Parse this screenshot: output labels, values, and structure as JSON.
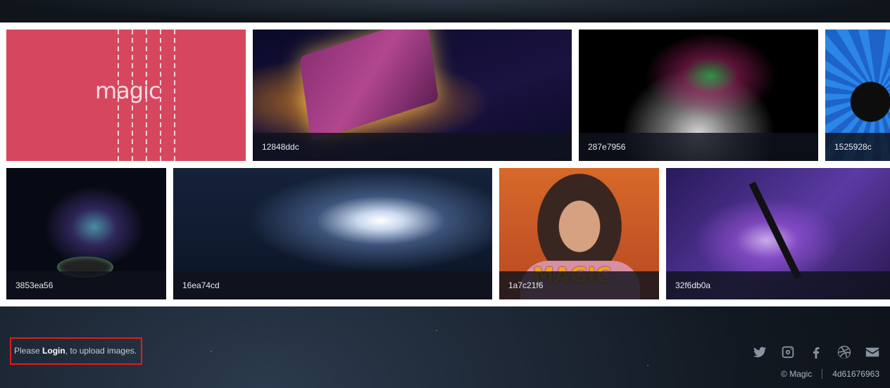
{
  "gallery": {
    "items": [
      {
        "label": "",
        "word": "magic"
      },
      {
        "label": "12848ddc"
      },
      {
        "label": "287e7956"
      },
      {
        "label": "1525928c"
      },
      {
        "label": "3853ea56"
      },
      {
        "label": "16ea74cd"
      },
      {
        "label": "1a7c21f6",
        "word": "MAGIC"
      },
      {
        "label": "32f6db0a"
      }
    ]
  },
  "footer": {
    "login_prefix": "Please ",
    "login_link": "Login",
    "login_suffix": ", to upload images.",
    "copyright": "© Magic",
    "version": "4d61676963"
  },
  "social": [
    "twitter-icon",
    "instagram-icon",
    "facebook-icon",
    "dribbble-icon",
    "envelope-icon"
  ]
}
